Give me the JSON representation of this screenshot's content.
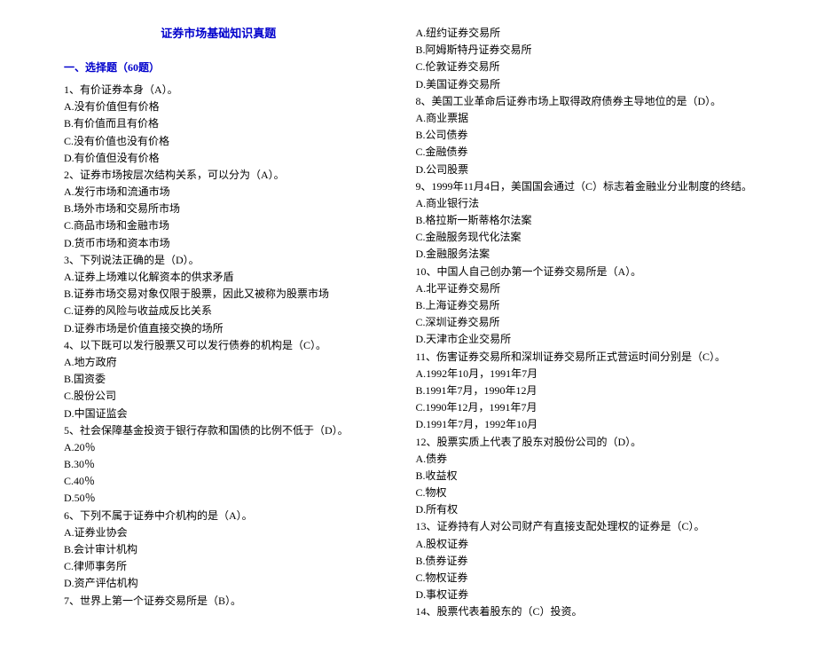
{
  "title": "证券市场基础知识真题",
  "section": "一、选择题（60题）",
  "col1": [
    "1、有价证券本身（A）。",
    "A.没有价值但有价格",
    "B.有价值而且有价格",
    "C.没有价值也没有价格",
    "D.有价值但没有价格",
    "2、证券市场按层次结构关系，可以分为（A）。",
    "A.发行市场和流通市场",
    "B.场外市场和交易所市场",
    "C.商品市场和金融市场",
    "D.货币市场和资本市场",
    "3、下列说法正确的是（D）。",
    "A.证券上场难以化解资本的供求矛盾",
    "B.证券市场交易对象仅限于股票，因此又被称为股票市场",
    "C.证券的风险与收益成反比关系",
    "D.证券市场是价值直接交换的场所",
    "4、以下既可以发行股票又可以发行债券的机构是（C）。",
    "A.地方政府",
    "B.国资委",
    "C.股份公司",
    "D.中国证监会",
    "5、社会保障基金投资于银行存款和国债的比例不低于（D）。",
    "A.20％",
    "B.30％",
    "C.40％",
    "D.50％",
    "6、下列不属于证券中介机构的是（A）。",
    "A.证券业协会",
    "B.会计审计机构",
    "C.律师事务所",
    "D.资产评估机构",
    "7、世界上第一个证券交易所是（B）。"
  ],
  "col2": [
    "A.纽约证券交易所",
    "B.阿姆斯特丹证券交易所",
    "C.伦敦证券交易所",
    "D.美国证券交易所",
    "8、美国工业革命后证券市场上取得政府债券主导地位的是（D）。",
    "A.商业票据",
    "B.公司债券",
    "C.金融债券",
    "D.公司股票",
    "9、1999年11月4日，美国国会通过（C）标志着金融业分业制度的终结。",
    "A.商业银行法",
    "B.格拉斯一斯蒂格尔法案",
    "C.金融服务现代化法案",
    "D.金融服务法案",
    "10、中国人自己创办第一个证券交易所是（A）。",
    "A.北平证券交易所",
    "B.上海证券交易所",
    "C.深圳证券交易所",
    "D.天津市企业交易所",
    "11、伤害证券交易所和深圳证券交易所正式营运时间分别是（C）。",
    "A.1992年10月，1991年7月",
    "B.1991年7月，1990年12月",
    "C.1990年12月，1991年7月",
    "D.1991年7月，1992年10月",
    "12、股票实质上代表了股东对股份公司的（D）。",
    "A.债券",
    "B.收益权",
    "C.物权",
    "D.所有权",
    "13、证券持有人对公司财产有直接支配处理权的证券是（C）。",
    "A.股权证券",
    "B.债券证券",
    "C.物权证券",
    "D.事权证券",
    "14、股票代表着股东的（C）投资。"
  ]
}
